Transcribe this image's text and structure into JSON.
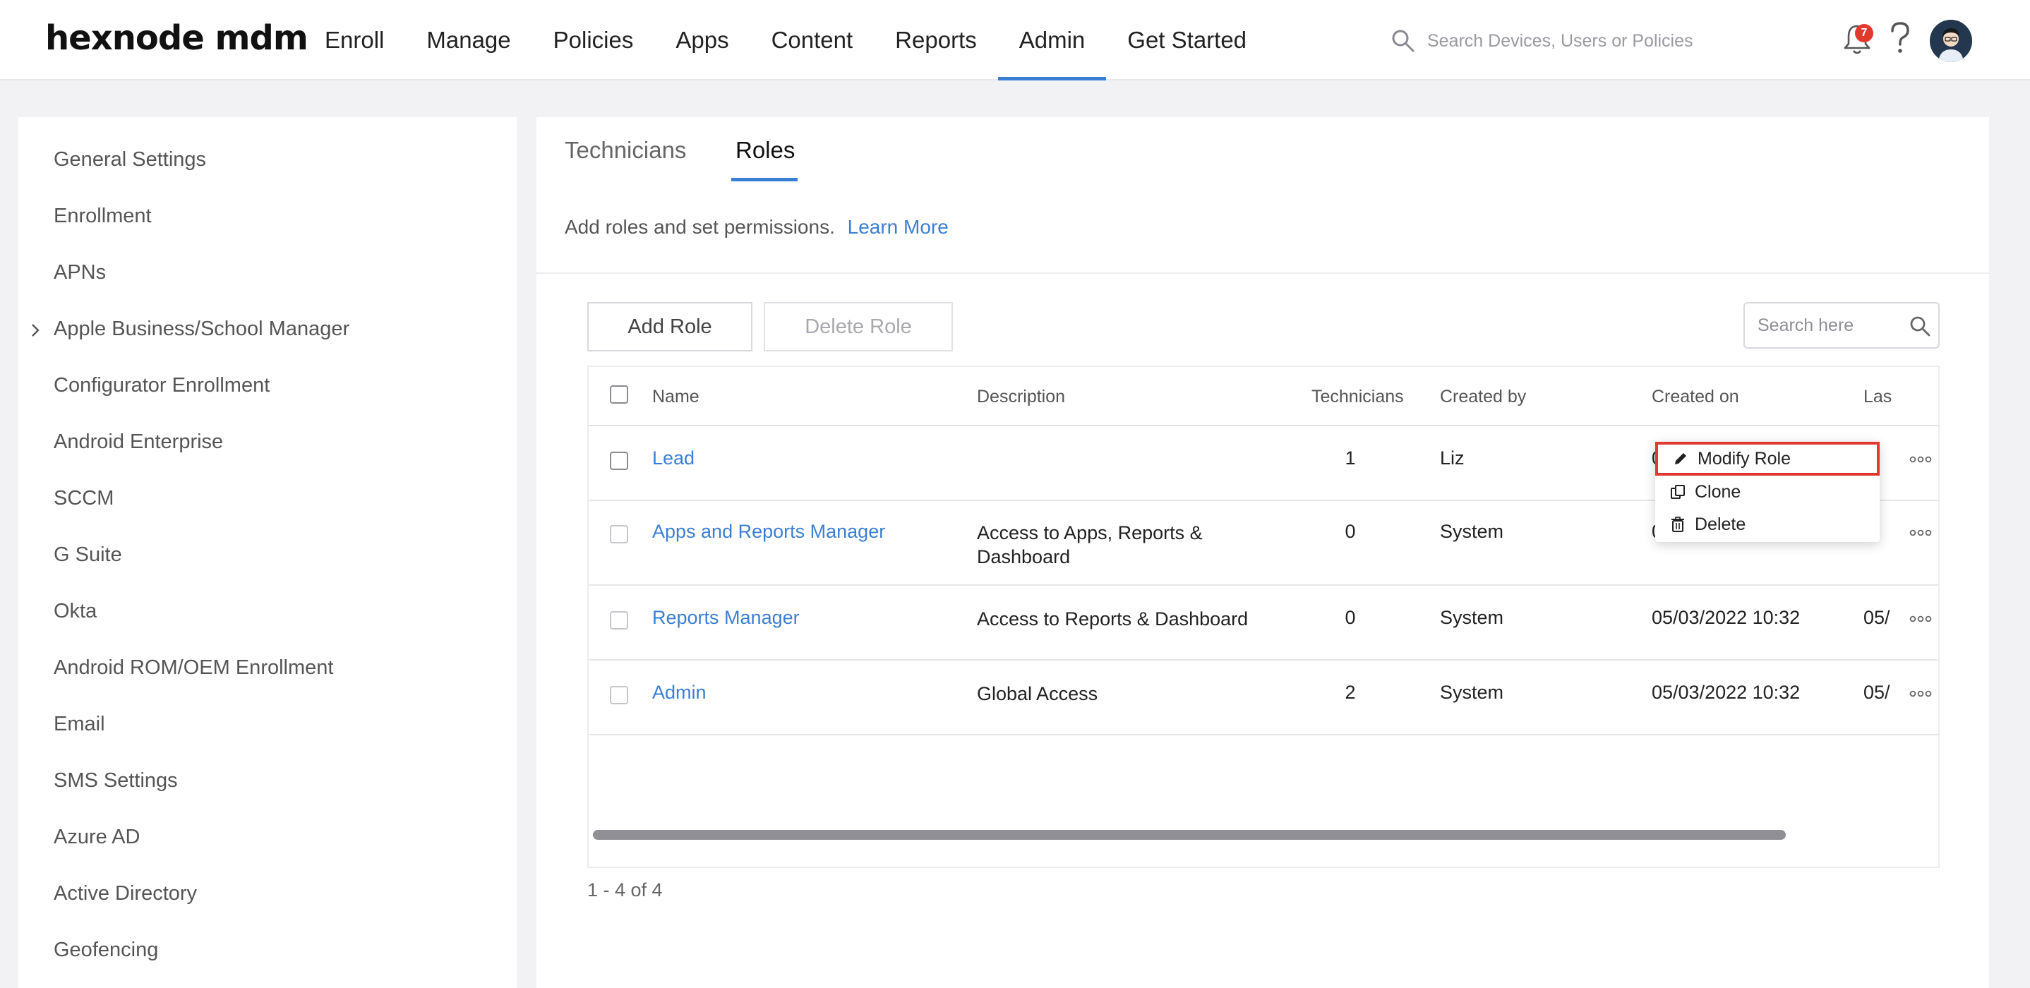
{
  "header": {
    "logo": "hexnode mdm",
    "nav": [
      {
        "label": "Enroll",
        "active": false
      },
      {
        "label": "Manage",
        "active": false
      },
      {
        "label": "Policies",
        "active": false
      },
      {
        "label": "Apps",
        "active": false
      },
      {
        "label": "Content",
        "active": false
      },
      {
        "label": "Reports",
        "active": false
      },
      {
        "label": "Admin",
        "active": true
      },
      {
        "label": "Get Started",
        "active": false
      }
    ],
    "search_placeholder": "Search Devices, Users or Policies",
    "notification_count": "7"
  },
  "sidebar": {
    "items": [
      {
        "label": "General Settings"
      },
      {
        "label": "Enrollment"
      },
      {
        "label": "APNs"
      },
      {
        "label": "Apple Business/School Manager",
        "expandable": true
      },
      {
        "label": "Configurator Enrollment"
      },
      {
        "label": "Android Enterprise"
      },
      {
        "label": "SCCM"
      },
      {
        "label": "G Suite"
      },
      {
        "label": "Okta"
      },
      {
        "label": "Android ROM/OEM Enrollment"
      },
      {
        "label": "Email"
      },
      {
        "label": "SMS Settings"
      },
      {
        "label": "Azure AD"
      },
      {
        "label": "Active Directory"
      },
      {
        "label": "Geofencing"
      }
    ]
  },
  "main": {
    "tabs": [
      {
        "label": "Technicians",
        "active": false
      },
      {
        "label": "Roles",
        "active": true
      }
    ],
    "description": "Add roles and set permissions.",
    "learn_more": "Learn More",
    "buttons": {
      "add_role": "Add Role",
      "delete_role": "Delete Role"
    },
    "table_search_placeholder": "Search here",
    "table": {
      "columns": [
        "Name",
        "Description",
        "Technicians",
        "Created by",
        "Created on",
        "Las"
      ],
      "rows": [
        {
          "name": "Lead",
          "description": "",
          "technicians": "1",
          "created_by": "Liz",
          "created_on": "0",
          "last": "/"
        },
        {
          "name": "Apps and Reports Manager",
          "description": "Access to Apps, Reports & Dashboard",
          "technicians": "0",
          "created_by": "System",
          "created_on": "0",
          "last": "/"
        },
        {
          "name": "Reports Manager",
          "description": "Access to Reports & Dashboard",
          "technicians": "0",
          "created_by": "System",
          "created_on": "05/03/2022 10:32",
          "last": "05/"
        },
        {
          "name": "Admin",
          "description": "Global Access",
          "technicians": "2",
          "created_by": "System",
          "created_on": "05/03/2022 10:32",
          "last": "05/"
        }
      ]
    },
    "pagination": "1 - 4 of 4",
    "context_menu": {
      "items": [
        {
          "label": "Modify Role",
          "icon": "pencil-icon",
          "highlighted": true
        },
        {
          "label": "Clone",
          "icon": "clone-icon",
          "highlighted": false
        },
        {
          "label": "Delete",
          "icon": "trash-icon",
          "highlighted": false
        }
      ]
    }
  },
  "colors": {
    "accent": "#3b7fd4",
    "badge": "#e03a2f",
    "page_bg": "#f2f2f4"
  }
}
